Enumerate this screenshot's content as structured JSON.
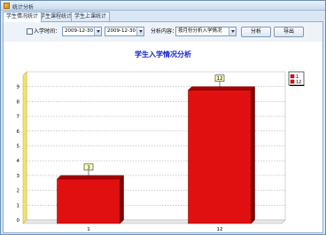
{
  "window": {
    "title": "统计分析"
  },
  "tabs": [
    {
      "label": "学生情况统计",
      "active": true
    },
    {
      "label": "学生课程统计",
      "active": false
    },
    {
      "label": "学生上课统计",
      "active": false
    }
  ],
  "toolbar": {
    "enrollment_time_label": "入学时间：",
    "enrollment_time_checked": false,
    "start_date": "2009-12-30",
    "end_date": "2009-12-30",
    "analysis_content_label": "分析内容：",
    "analysis_content_value": "按月份分析入学情况",
    "analyze_button": "分析",
    "export_button": "导出"
  },
  "chart_data": {
    "type": "bar",
    "title": "学生入学情况分析",
    "categories": [
      "1",
      "12"
    ],
    "values": [
      3,
      9
    ],
    "data_labels": [
      "3",
      "12"
    ],
    "ylim": [
      0,
      10
    ],
    "yticks": [
      "0",
      "1",
      "2",
      "3",
      "4",
      "5",
      "6",
      "7",
      "8",
      "9"
    ],
    "legend": [
      "1",
      "12"
    ],
    "legend_position": "top-right",
    "grid": true,
    "bar_color": "#e01010"
  }
}
